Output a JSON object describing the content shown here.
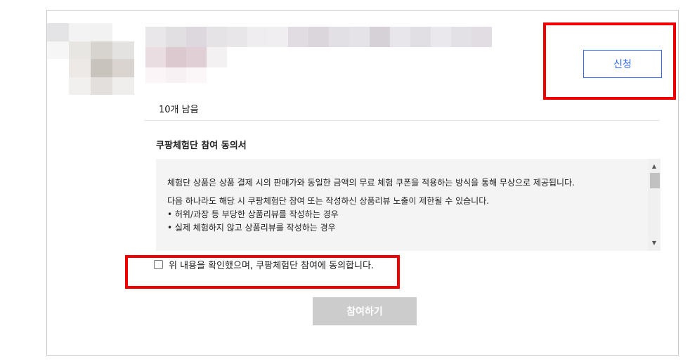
{
  "header": {
    "fragment": ""
  },
  "product": {
    "remaining_label": "10개 남음",
    "apply_label": "신청"
  },
  "consent": {
    "title": "쿠팡체험단 참여 동의서",
    "paragraph_1": "체험단 상품은 상품 결제 시의 판매가와 동일한 금액의 무료 체험 쿠폰을 적용하는 방식을 통해 무상으로 제공됩니다.",
    "paragraph_2": "다음 하나라도 해당 시 쿠팡체험단 참여 또는 작성하신 상품리뷰 노출이 제한될 수 있습니다.",
    "bullets": [
      "• 허위/과장 등 부당한 상품리뷰를 작성하는 경우",
      "• 실제 체험하지 않고 상품리뷰를 작성하는 경우"
    ],
    "agree_label": "위 내용을 확인했으며, 쿠팡체험단 참여에 동의합니다.",
    "agree_checked": false
  },
  "join_button_label": "참여하기",
  "colors": {
    "accent": "#346aff",
    "highlight": "#f00000",
    "disabled_button": "#cccccc"
  }
}
